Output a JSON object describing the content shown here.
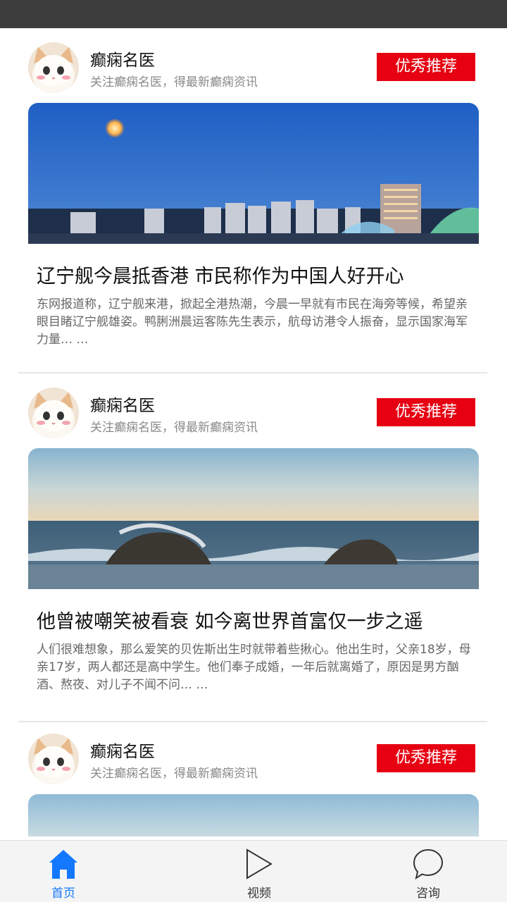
{
  "colors": {
    "accent_red": "#e60012",
    "tab_active": "#1478ff"
  },
  "feed": {
    "posts": [
      {
        "author_name": "癫痫名医",
        "author_desc": "关注癫痫名医，得最新癫痫资讯",
        "badge": "优秀推荐",
        "image": "city-night-moon",
        "headline": "辽宁舰今晨抵香港 市民称作为中国人好开心",
        "summary": "东网报道称，辽宁舰来港，掀起全港热潮，今晨一早就有市民在海旁等候，希望亲眼目睹辽宁舰雄姿。鸭脷洲晨运客陈先生表示，航母访港令人振奋，显示国家海军力量… …"
      },
      {
        "author_name": "癫痫名医",
        "author_desc": "关注癫痫名医，得最新癫痫资讯",
        "badge": "优秀推荐",
        "image": "sea-waves-rocks",
        "headline": "他曾被嘲笑被看衰 如今离世界首富仅一步之遥",
        "summary": "人们很难想象，那么爱笑的贝佐斯出生时就带着些揪心。他出生时，父亲18岁，母亲17岁，两人都还是高中学生。他们奉子成婚，一年后就离婚了，原因是男方酗酒、熬夜、对儿子不闻不问… …"
      },
      {
        "author_name": "癫痫名医",
        "author_desc": "关注癫痫名医，得最新癫痫资讯",
        "badge": "优秀推荐",
        "image": "sky"
      }
    ]
  },
  "tabbar": {
    "items": [
      {
        "label": "首页",
        "icon": "home-icon",
        "active": true
      },
      {
        "label": "视频",
        "icon": "play-icon",
        "active": false
      },
      {
        "label": "咨询",
        "icon": "chat-bubble-icon",
        "active": false
      }
    ]
  }
}
